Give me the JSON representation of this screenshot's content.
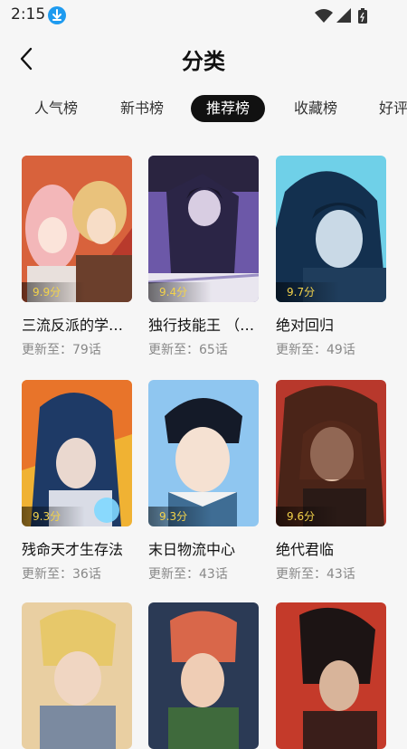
{
  "status": {
    "time": "2:15"
  },
  "header": {
    "title": "分类"
  },
  "tabs": [
    {
      "label": "人气榜"
    },
    {
      "label": "新书榜"
    },
    {
      "label": "推荐榜",
      "active": true
    },
    {
      "label": "收藏榜"
    },
    {
      "label": "好评"
    }
  ],
  "comics": [
    {
      "name": "三流反派的学…",
      "update": "更新至：79话",
      "score": "9.9分"
    },
    {
      "name": "独行技能王 （…",
      "update": "更新至：65话",
      "score": "9.4分"
    },
    {
      "name": "绝对回归",
      "update": "更新至：49话",
      "score": "9.7分"
    },
    {
      "name": "残命天才生存法",
      "update": "更新至：36话",
      "score": "9.3分"
    },
    {
      "name": "末日物流中心",
      "update": "更新至：43话",
      "score": "9.3分"
    },
    {
      "name": "绝代君临",
      "update": "更新至：43话",
      "score": "9.6分"
    },
    {
      "name": "",
      "update": "",
      "score": ""
    },
    {
      "name": "",
      "update": "",
      "score": ""
    },
    {
      "name": "",
      "update": "",
      "score": ""
    }
  ],
  "colors": {
    "accent": "#111111",
    "score": "#f2d24b",
    "download_badge": "#1e9bf0"
  }
}
